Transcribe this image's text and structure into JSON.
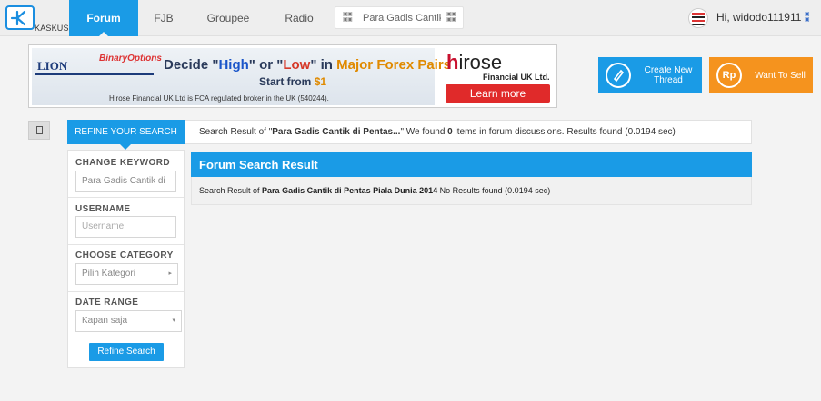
{
  "nav": {
    "logo_text": "KASKUS",
    "items": [
      {
        "label": "Forum"
      },
      {
        "label": "FJB"
      },
      {
        "label": "Groupee"
      },
      {
        "label": "Radio"
      }
    ],
    "search_value": "Para Gadis Cantik di Pentas",
    "user_greeting": "Hi, widodo111911"
  },
  "banner": {
    "brand_left": "LION",
    "brand_left_sub": "BinaryOptions",
    "headline_prefix": "Decide \"",
    "headline_high": "High",
    "headline_mid": "\" or \"",
    "headline_low": "Low",
    "headline_mid2": "\" in ",
    "headline_major": "Major Forex Pairs",
    "start_prefix": "Start from ",
    "start_amount": "$1",
    "regulatory_note": "Hirose Financial UK Ltd is FCA regulated broker in the UK (540244).",
    "brand_right": "irose",
    "brand_right_h": "h",
    "brand_right_sub": "Financial UK Ltd.",
    "cta": "Learn more"
  },
  "actions": {
    "create_thread": "Create New Thread",
    "want_to_sell": "Want To Sell",
    "sell_icon_text": "Rp"
  },
  "refine": {
    "tab_label": "REFINE YOUR SEARCH",
    "result_prefix": "Search Result of \"",
    "result_query": "Para Gadis Cantik di Pentas...",
    "result_mid": "\" We found ",
    "result_count": "0",
    "result_suffix": " items in forum discussions. Results found (0.0194 sec)"
  },
  "sidebar": {
    "keyword_title": "CHANGE KEYWORD",
    "keyword_value": "Para Gadis Cantik di",
    "username_title": "USERNAME",
    "username_placeholder": "Username",
    "category_title": "CHOOSE CATEGORY",
    "category_value": "Pilih Kategori",
    "date_title": "DATE RANGE",
    "date_value": "Kapan saja",
    "refine_button": "Refine Search"
  },
  "results": {
    "heading": "Forum Search Result",
    "text_prefix": "Search Result of ",
    "text_query": "Para Gadis Cantik di Pentas Piala Dunia 2014",
    "text_suffix": " No Results found (0.0194 sec)"
  },
  "colors": {
    "accent": "#1a9be6",
    "sell": "#f5931e"
  }
}
